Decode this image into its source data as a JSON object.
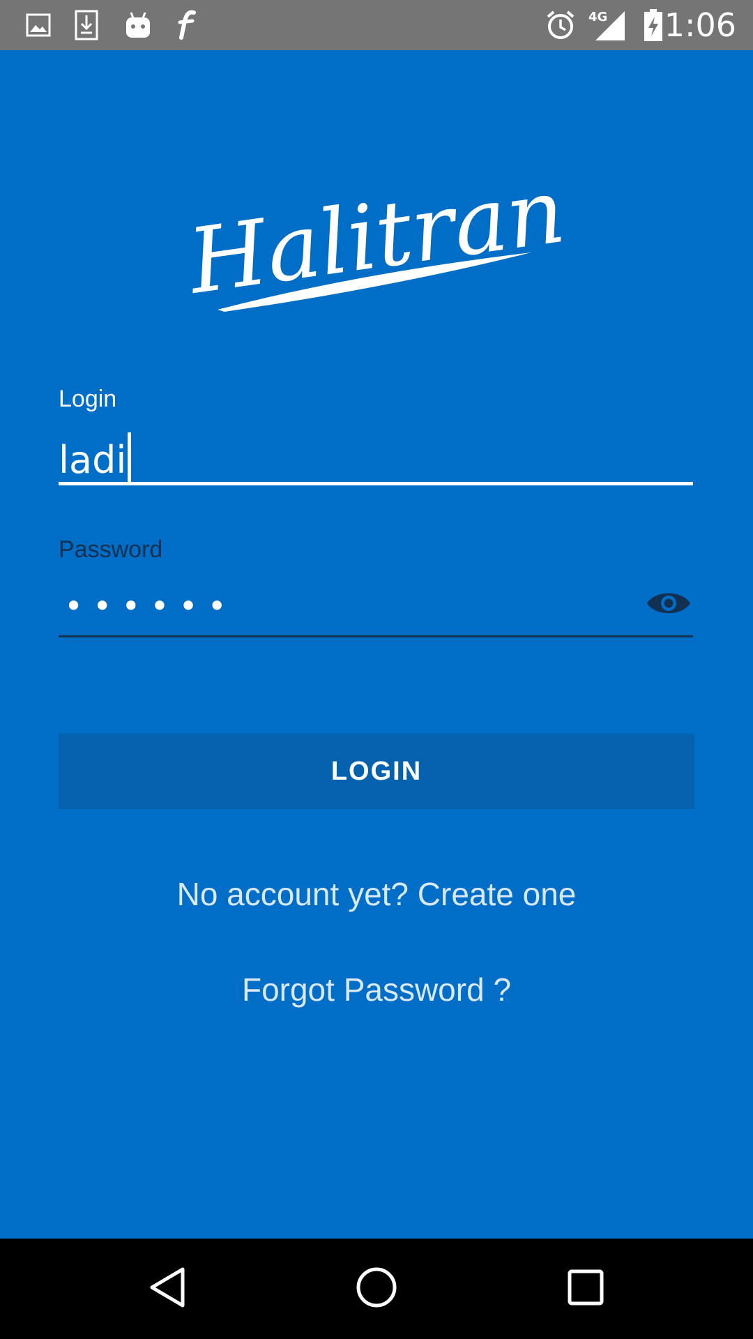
{
  "status_bar": {
    "time": "1:06",
    "network_label": "4G",
    "left_icons": [
      "gallery-icon",
      "download-icon",
      "android-icon",
      "font-f-icon"
    ],
    "right_icons": [
      "alarm-icon",
      "signal-4g-icon",
      "battery-charging-icon"
    ]
  },
  "app": {
    "logo_text": "Halitran",
    "colors": {
      "background": "#006EC6",
      "button": "#0461AE",
      "dark_label": "#123052"
    }
  },
  "form": {
    "login": {
      "label": "Login",
      "value": "ladi"
    },
    "password": {
      "label": "Password",
      "masked_value": "••••••",
      "toggle_icon": "eye-icon"
    },
    "submit_label": "LOGIN"
  },
  "links": {
    "create_account": "No account yet? Create one",
    "forgot_password": "Forgot Password ?"
  },
  "nav_bar": {
    "buttons": [
      "back-icon",
      "home-icon",
      "recents-icon"
    ]
  }
}
